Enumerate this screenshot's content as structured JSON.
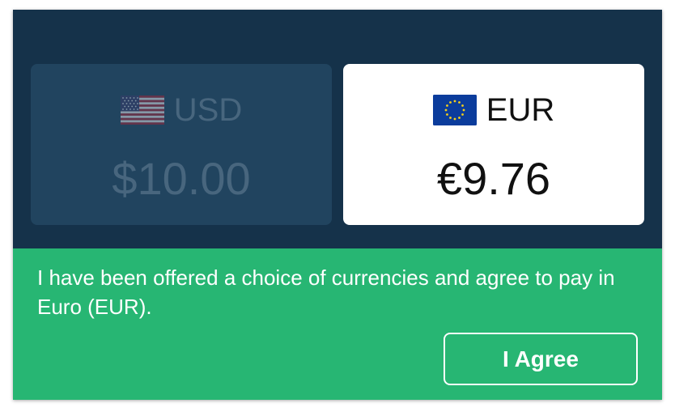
{
  "currency_options": [
    {
      "code": "USD",
      "amount": "$10.00",
      "flag_icon": "us-flag-icon",
      "selected": false
    },
    {
      "code": "EUR",
      "amount": "€9.76",
      "flag_icon": "eu-flag-icon",
      "selected": true
    }
  ],
  "consent_text": "I have been offered a choice of currencies and agree to pay in Euro (EUR).",
  "agree_button_label": "I Agree",
  "colors": {
    "header_bg": "#15324a",
    "unselected_card_bg": "#21445f",
    "selected_card_bg": "#ffffff",
    "footer_bg": "#27b673"
  }
}
